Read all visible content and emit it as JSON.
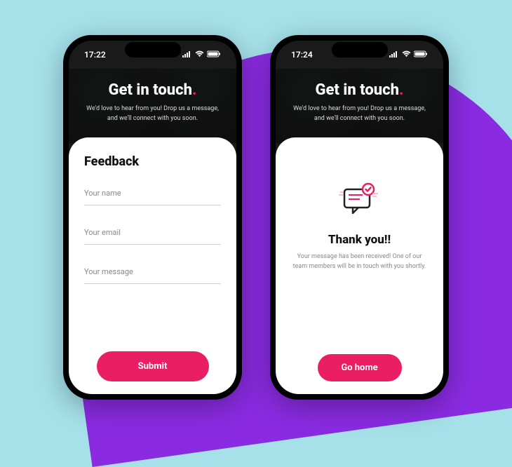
{
  "colors": {
    "accent": "#e91e63",
    "bg_cyan": "#a6e1ea",
    "bg_purple": "#8a2be2"
  },
  "phones": [
    {
      "time": "17:22",
      "hero": {
        "title": "Get in touch",
        "tagline": "We'd love to hear from you! Drop us a message, and we'll connect with you soon."
      },
      "form": {
        "heading": "Feedback",
        "name_placeholder": "Your name",
        "email_placeholder": "Your email",
        "message_placeholder": "Your message",
        "submit_label": "Submit"
      }
    },
    {
      "time": "17:24",
      "hero": {
        "title": "Get in touch",
        "tagline": "We'd love to hear from you! Drop us a message, and we'll connect with you soon."
      },
      "confirm": {
        "heading": "Thank you!!",
        "body": "Your message has been received! One of our team members will be in touch with you shortly.",
        "button_label": "Go home"
      }
    }
  ]
}
